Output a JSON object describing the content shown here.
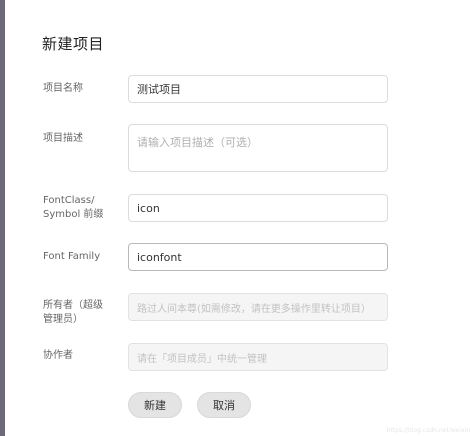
{
  "page": {
    "title": "新建项目"
  },
  "form": {
    "name": {
      "label": "项目名称",
      "value": "测试项目"
    },
    "description": {
      "label": "项目描述",
      "placeholder": "请输入项目描述（可选）"
    },
    "font_class": {
      "label_line1": "FontClass/",
      "label_line2": "Symbol 前缀",
      "value": "icon"
    },
    "font_family": {
      "label": "Font Family",
      "value": "iconfont"
    },
    "owner": {
      "label_line1": "所有者（超级",
      "label_line2": "管理员）",
      "placeholder": "路过人间本尊(如需修改，请在更多操作里转让项目）"
    },
    "collaborators": {
      "label": "协作者",
      "placeholder": "请在「项目成员」中统一管理"
    }
  },
  "actions": {
    "create_label": "新建",
    "cancel_label": "取消"
  },
  "watermark": "https://blog.csdn.net/weixin"
}
